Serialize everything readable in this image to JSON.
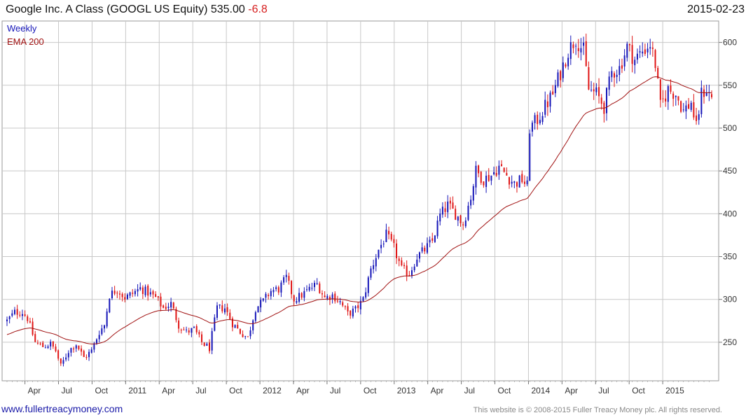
{
  "header": {
    "title": "Google Inc. A Class (GOOGL US Equity)",
    "last": "535.00",
    "change": "-6.8",
    "date": "2015-02-23"
  },
  "footer": {
    "website": "www.fullertreacymoney.com",
    "copyright": "This website is © 2008-2015 Fuller Treacy Money plc. All rights reserved."
  },
  "chart_data": {
    "type": "candlestick",
    "title": "Google Inc. A Class (GOOGL US Equity)",
    "frequency_label": "Weekly",
    "ylim": [
      205,
      625
    ],
    "y_ticks": [
      250,
      300,
      350,
      400,
      450,
      500,
      550,
      600
    ],
    "y_axis_side": "right",
    "x_ticks": [
      "Apr",
      "Jul",
      "Oct",
      "2011",
      "Apr",
      "Jul",
      "Oct",
      "2012",
      "Apr",
      "Jul",
      "Oct",
      "2013",
      "Apr",
      "Jul",
      "Oct",
      "2014",
      "Apr",
      "Jul",
      "Oct",
      "2015"
    ],
    "grid": true,
    "colors": {
      "up": "#1515b8",
      "down": "#e01515",
      "ema": "#a01010",
      "grid": "#c8c8c8"
    },
    "price_anchors": [
      {
        "t": 0,
        "c": 275
      },
      {
        "t": 3,
        "c": 285
      },
      {
        "t": 6,
        "c": 285
      },
      {
        "t": 8,
        "c": 278
      },
      {
        "t": 11,
        "c": 250
      },
      {
        "t": 14,
        "c": 245
      },
      {
        "t": 17,
        "c": 248
      },
      {
        "t": 19,
        "c": 240
      },
      {
        "t": 21,
        "c": 222
      },
      {
        "t": 24,
        "c": 240
      },
      {
        "t": 27,
        "c": 248
      },
      {
        "t": 30,
        "c": 232
      },
      {
        "t": 33,
        "c": 240
      },
      {
        "t": 36,
        "c": 262
      },
      {
        "t": 38,
        "c": 270
      },
      {
        "t": 40,
        "c": 305
      },
      {
        "t": 43,
        "c": 312
      },
      {
        "t": 46,
        "c": 302
      },
      {
        "t": 49,
        "c": 307
      },
      {
        "t": 52,
        "c": 313
      },
      {
        "t": 55,
        "c": 308
      },
      {
        "t": 58,
        "c": 302
      },
      {
        "t": 61,
        "c": 290
      },
      {
        "t": 64,
        "c": 295
      },
      {
        "t": 67,
        "c": 270
      },
      {
        "t": 70,
        "c": 262
      },
      {
        "t": 73,
        "c": 265
      },
      {
        "t": 76,
        "c": 250
      },
      {
        "t": 79,
        "c": 243
      },
      {
        "t": 82,
        "c": 290
      },
      {
        "t": 85,
        "c": 290
      },
      {
        "t": 88,
        "c": 272
      },
      {
        "t": 91,
        "c": 262
      },
      {
        "t": 94,
        "c": 255
      },
      {
        "t": 97,
        "c": 290
      },
      {
        "t": 100,
        "c": 298
      },
      {
        "t": 103,
        "c": 310
      },
      {
        "t": 106,
        "c": 312
      },
      {
        "t": 109,
        "c": 325
      },
      {
        "t": 112,
        "c": 300
      },
      {
        "t": 115,
        "c": 305
      },
      {
        "t": 118,
        "c": 312
      },
      {
        "t": 121,
        "c": 318
      },
      {
        "t": 124,
        "c": 302
      },
      {
        "t": 127,
        "c": 305
      },
      {
        "t": 130,
        "c": 297
      },
      {
        "t": 133,
        "c": 283
      },
      {
        "t": 136,
        "c": 288
      },
      {
        "t": 139,
        "c": 300
      },
      {
        "t": 142,
        "c": 335
      },
      {
        "t": 145,
        "c": 358
      },
      {
        "t": 148,
        "c": 375
      },
      {
        "t": 151,
        "c": 360
      },
      {
        "t": 154,
        "c": 335
      },
      {
        "t": 157,
        "c": 330
      },
      {
        "t": 160,
        "c": 350
      },
      {
        "t": 163,
        "c": 358
      },
      {
        "t": 166,
        "c": 368
      },
      {
        "t": 169,
        "c": 398
      },
      {
        "t": 172,
        "c": 410
      },
      {
        "t": 175,
        "c": 400
      },
      {
        "t": 178,
        "c": 388
      },
      {
        "t": 181,
        "c": 420
      },
      {
        "t": 183,
        "c": 450
      },
      {
        "t": 186,
        "c": 440
      },
      {
        "t": 189,
        "c": 445
      },
      {
        "t": 192,
        "c": 455
      },
      {
        "t": 195,
        "c": 445
      },
      {
        "t": 198,
        "c": 435
      },
      {
        "t": 201,
        "c": 440
      },
      {
        "t": 203,
        "c": 432
      },
      {
        "t": 204,
        "c": 500
      },
      {
        "t": 207,
        "c": 510
      },
      {
        "t": 210,
        "c": 525
      },
      {
        "t": 213,
        "c": 540
      },
      {
        "t": 216,
        "c": 565
      },
      {
        "t": 219,
        "c": 590
      },
      {
        "t": 222,
        "c": 605
      },
      {
        "t": 225,
        "c": 590
      },
      {
        "t": 227,
        "c": 545
      },
      {
        "t": 230,
        "c": 540
      },
      {
        "t": 233,
        "c": 525
      },
      {
        "t": 236,
        "c": 565
      },
      {
        "t": 239,
        "c": 570
      },
      {
        "t": 242,
        "c": 595
      },
      {
        "t": 245,
        "c": 580
      },
      {
        "t": 248,
        "c": 590
      },
      {
        "t": 251,
        "c": 598
      },
      {
        "t": 253,
        "c": 575
      },
      {
        "t": 255,
        "c": 525
      },
      {
        "t": 258,
        "c": 545
      },
      {
        "t": 261,
        "c": 540
      },
      {
        "t": 264,
        "c": 520
      },
      {
        "t": 267,
        "c": 530
      },
      {
        "t": 269,
        "c": 500
      },
      {
        "t": 271,
        "c": 540
      },
      {
        "t": 273,
        "c": 545
      },
      {
        "t": 275,
        "c": 535
      }
    ]
  }
}
